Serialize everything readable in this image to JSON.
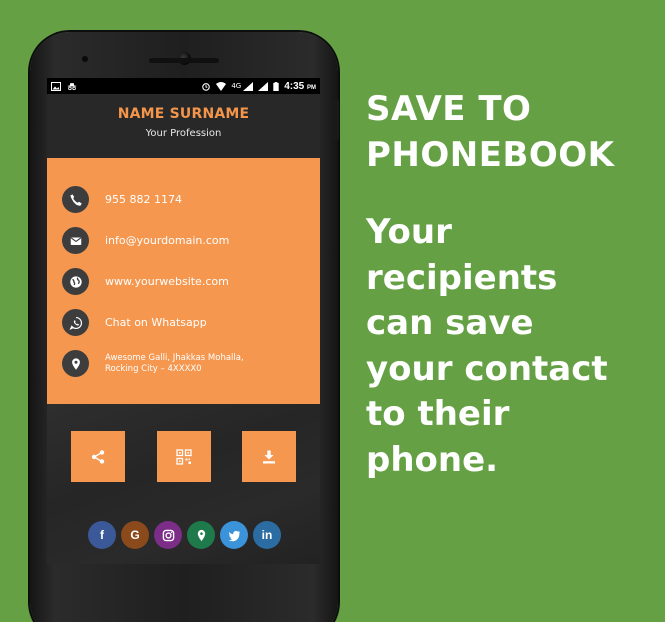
{
  "status_bar": {
    "time": "4:35",
    "ampm": "PM",
    "network": "4G",
    "icons": [
      "image-icon",
      "incognito-icon",
      "alarm-icon",
      "wifi-icon",
      "signal-icon",
      "signal-icon",
      "battery-icon"
    ]
  },
  "card": {
    "name": "NAME SURNAME",
    "profession": "Your Profession",
    "rows": [
      {
        "icon": "phone-icon",
        "text": "955 882 1174"
      },
      {
        "icon": "mail-icon",
        "text": "info@yourdomain.com"
      },
      {
        "icon": "globe-icon",
        "text": "www.yourwebsite.com"
      },
      {
        "icon": "whatsapp-icon",
        "text": "Chat on Whatsapp"
      },
      {
        "icon": "location-icon",
        "text_line1": "Awesome Galli, Jhakkas Mohalla,",
        "text_line2": "Rocking City – 4XXXX0"
      }
    ]
  },
  "actions": [
    {
      "icon": "share-icon"
    },
    {
      "icon": "qr-code-icon"
    },
    {
      "icon": "download-icon"
    }
  ],
  "social": [
    {
      "icon": "facebook-icon",
      "label": "f",
      "color": "#3b5998"
    },
    {
      "icon": "google-icon",
      "label": "G",
      "color": "#8b4a1c"
    },
    {
      "icon": "instagram-icon",
      "label": "",
      "color": "#7b2d87"
    },
    {
      "icon": "maps-icon",
      "label": "",
      "color": "#1e7a4a"
    },
    {
      "icon": "twitter-icon",
      "label": "",
      "color": "#3b94d9"
    },
    {
      "icon": "linkedin-icon",
      "label": "in",
      "color": "#2b6ca3"
    }
  ],
  "headline": {
    "line1": "SAVE TO",
    "line2": "PHONEBOOK"
  },
  "body": {
    "line1": "Your",
    "line2": "recipients",
    "line3": "can save",
    "line4": "your contact",
    "line5": "to their",
    "line6": "phone."
  },
  "colors": {
    "background": "#65a144",
    "accent": "#f5974f",
    "dark": "#262626"
  }
}
